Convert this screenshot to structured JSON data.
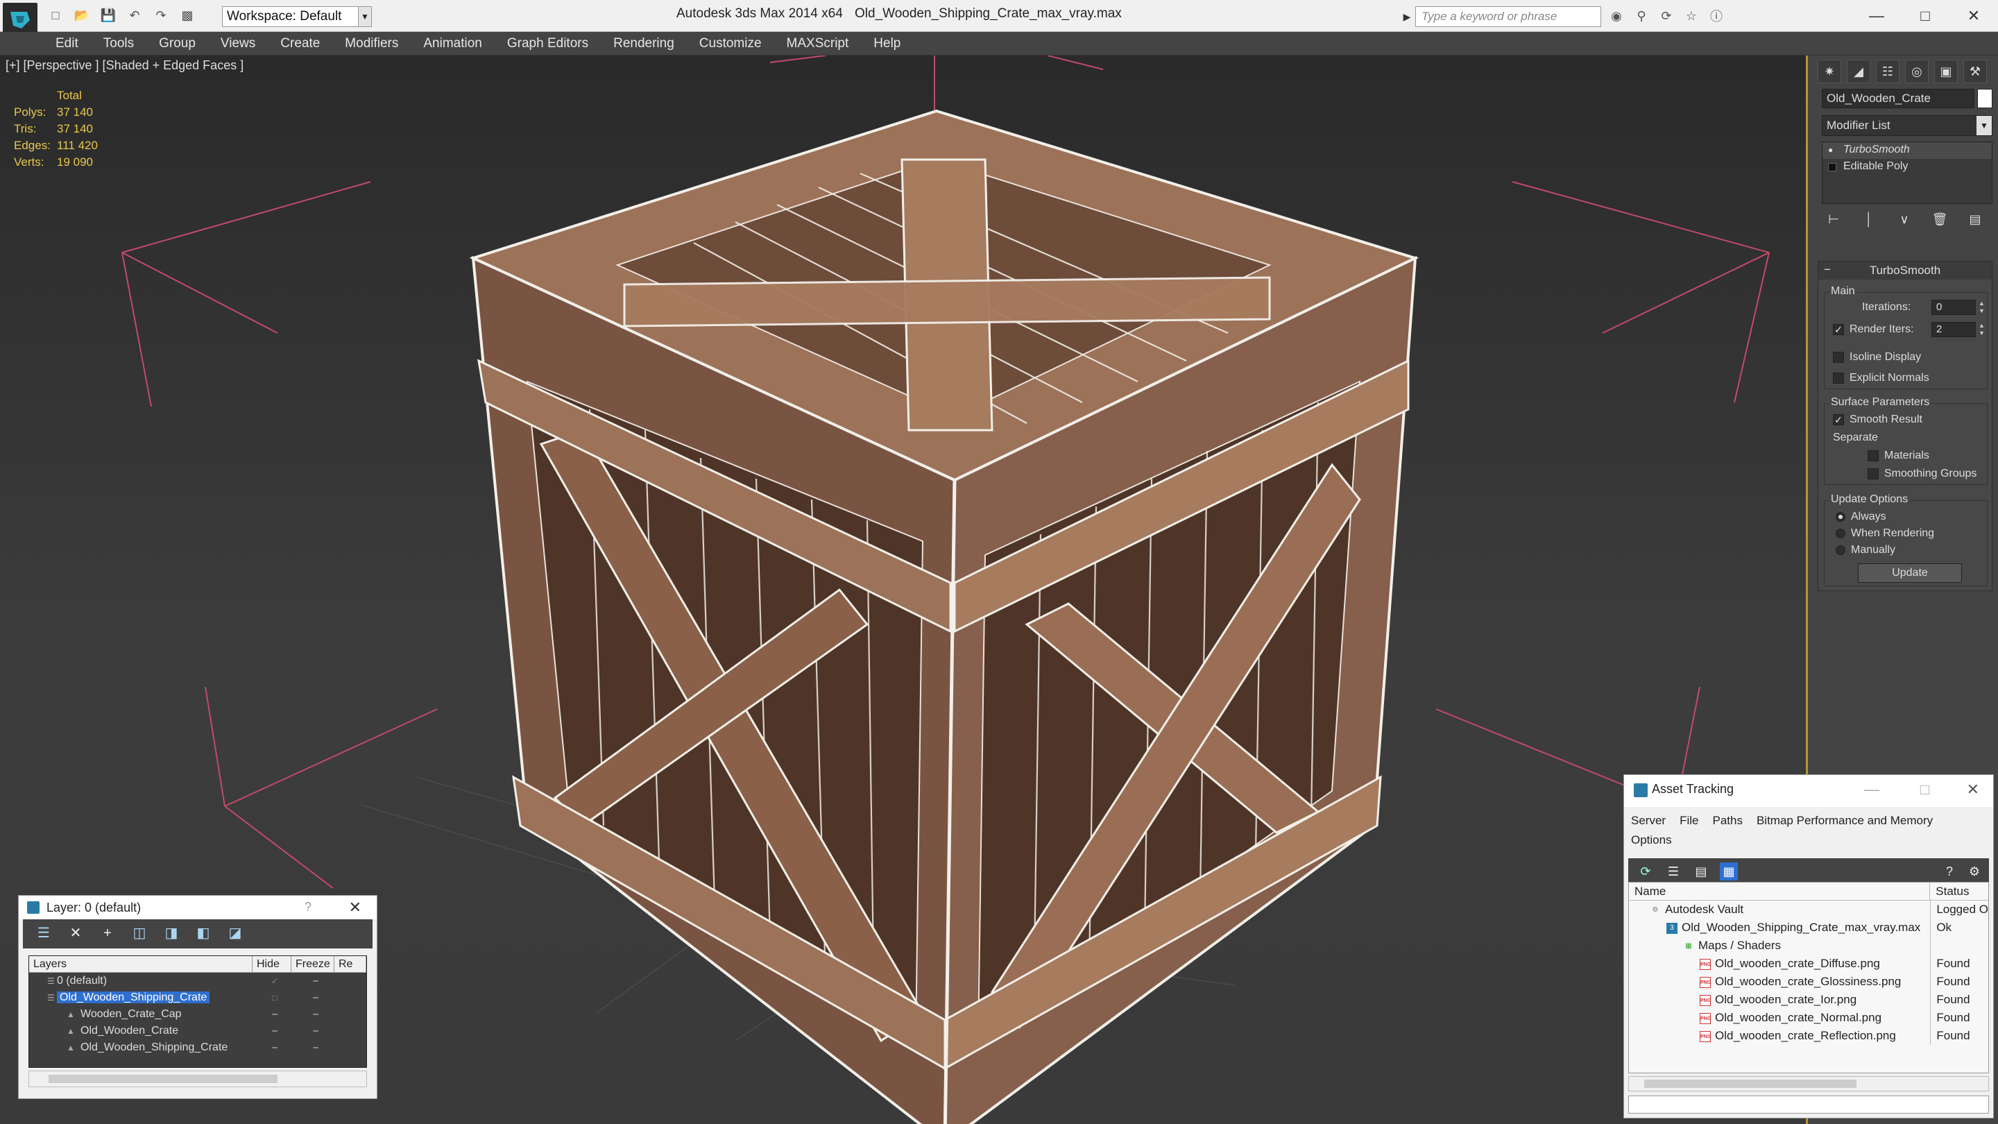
{
  "titlebar": {
    "workspace": "Workspace: Default",
    "app_title": "Autodesk 3ds Max  2014 x64",
    "file_title": "Old_Wooden_Shipping_Crate_max_vray.max",
    "search_placeholder": "Type a keyword or phrase"
  },
  "menu": [
    "Edit",
    "Tools",
    "Group",
    "Views",
    "Create",
    "Modifiers",
    "Animation",
    "Graph Editors",
    "Rendering",
    "Customize",
    "MAXScript",
    "Help"
  ],
  "viewport": {
    "label": "[+] [Perspective ] [Shaded + Edged Faces ]",
    "stats": {
      "header": "Total",
      "rows": [
        {
          "k": "Polys:",
          "v": "37 140"
        },
        {
          "k": "Tris:",
          "v": "37 140"
        },
        {
          "k": "Edges:",
          "v": "111 420"
        },
        {
          "k": "Verts:",
          "v": "19 090"
        }
      ]
    }
  },
  "command_panel": {
    "object_name": "Old_Wooden_Crate",
    "modifier_list": "Modifier List",
    "stack": [
      {
        "label": "TurboSmooth",
        "selected": true
      },
      {
        "label": "Editable Poly",
        "selected": false
      }
    ],
    "rollout": {
      "title": "TurboSmooth",
      "main_label": "Main",
      "iterations_label": "Iterations:",
      "iterations": "0",
      "render_iters_label": "Render Iters:",
      "render_iters": "2",
      "isoline": "Isoline Display",
      "explicit": "Explicit Normals",
      "surface_label": "Surface Parameters",
      "smooth_result": "Smooth Result",
      "separate": "Separate",
      "materials": "Materials",
      "smoothing_groups": "Smoothing Groups",
      "update_label": "Update Options",
      "always": "Always",
      "when_rendering": "When Rendering",
      "manually": "Manually",
      "update_button": "Update"
    }
  },
  "layer_window": {
    "title": "Layer: 0 (default)",
    "help": "?",
    "columns": [
      "Layers",
      "Hide",
      "Freeze",
      "Re"
    ],
    "rows": [
      {
        "name": "0 (default)",
        "indent": 0,
        "selected": false
      },
      {
        "name": "Old_Wooden_Shipping_Crate",
        "indent": 0,
        "selected": true
      },
      {
        "name": "Wooden_Crate_Cap",
        "indent": 1,
        "selected": false
      },
      {
        "name": "Old_Wooden_Crate",
        "indent": 1,
        "selected": false
      },
      {
        "name": "Old_Wooden_Shipping_Crate",
        "indent": 1,
        "selected": false
      }
    ]
  },
  "asset_window": {
    "title": "Asset Tracking",
    "menu": [
      "Server",
      "File",
      "Paths",
      "Bitmap Performance and Memory",
      "Options"
    ],
    "columns": [
      "Name",
      "Status"
    ],
    "rows": [
      {
        "name": "Autodesk Vault",
        "status": "Logged O",
        "indent": 0,
        "icon": "vault"
      },
      {
        "name": "Old_Wooden_Shipping_Crate_max_vray.max",
        "status": "Ok",
        "indent": 1,
        "icon": "max"
      },
      {
        "name": "Maps / Shaders",
        "status": "",
        "indent": 2,
        "icon": "folder"
      },
      {
        "name": "Old_wooden_crate_Diffuse.png",
        "status": "Found",
        "indent": 3,
        "icon": "png"
      },
      {
        "name": "Old_wooden_crate_Glossiness.png",
        "status": "Found",
        "indent": 3,
        "icon": "png"
      },
      {
        "name": "Old_wooden_crate_Ior.png",
        "status": "Found",
        "indent": 3,
        "icon": "png"
      },
      {
        "name": "Old_wooden_crate_Normal.png",
        "status": "Found",
        "indent": 3,
        "icon": "png"
      },
      {
        "name": "Old_wooden_crate_Reflection.png",
        "status": "Found",
        "indent": 3,
        "icon": "png"
      }
    ]
  },
  "colors": {
    "stats": "#e8c84a",
    "viewport_border": "#b8962e",
    "selection": "#2f6fd0",
    "wood": "#8a6048"
  }
}
